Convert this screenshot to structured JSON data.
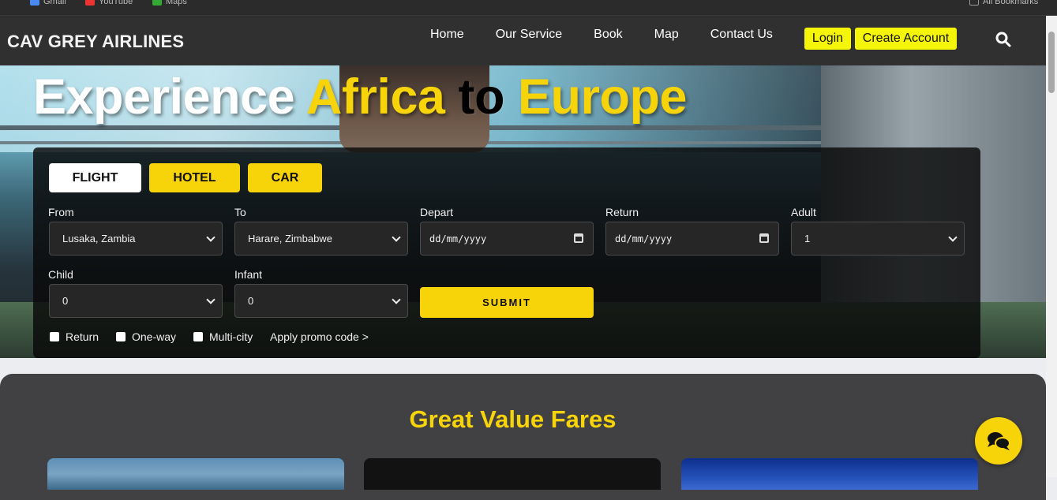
{
  "browser": {
    "bookmarks": [
      {
        "label": "Gmail",
        "icon": "gmail-icon"
      },
      {
        "label": "YouTube",
        "icon": "youtube-icon"
      },
      {
        "label": "Maps",
        "icon": "maps-icon"
      }
    ],
    "all_bookmarks": "All Bookmarks"
  },
  "nav": {
    "brand": "CAV GREY AIRLINES",
    "links": [
      "Home",
      "Our Service",
      "Book",
      "Map",
      "Contact Us"
    ],
    "login": "Login",
    "create_account": "Create Account",
    "search_icon": "search-icon"
  },
  "hero": {
    "headline": {
      "word1": "Experience",
      "word2": "Africa",
      "word3": "to",
      "word4": "Europe"
    }
  },
  "booking": {
    "tabs": [
      "FLIGHT",
      "HOTEL",
      "CAR"
    ],
    "active_tab": "FLIGHT",
    "fields": {
      "from": {
        "label": "From",
        "value": "Lusaka, Zambia"
      },
      "to": {
        "label": "To",
        "value": "Harare, Zimbabwe"
      },
      "depart": {
        "label": "Depart",
        "value": "dd/mm/yyyy"
      },
      "return": {
        "label": "Return",
        "value": "dd/mm/yyyy"
      },
      "adult": {
        "label": "Adult",
        "value": "1"
      },
      "child": {
        "label": "Child",
        "value": "0"
      },
      "infant": {
        "label": "Infant",
        "value": "0"
      }
    },
    "submit": "SUBMIT",
    "options": [
      "Return",
      "One-way",
      "Multi-city"
    ],
    "promo": "Apply promo code >"
  },
  "fares": {
    "title": "Great Value Fares"
  },
  "colors": {
    "accent": "#f7d30a",
    "nav_bg": "#303030",
    "button_yellow": "#f5f50a",
    "fares_bg": "#414143"
  }
}
